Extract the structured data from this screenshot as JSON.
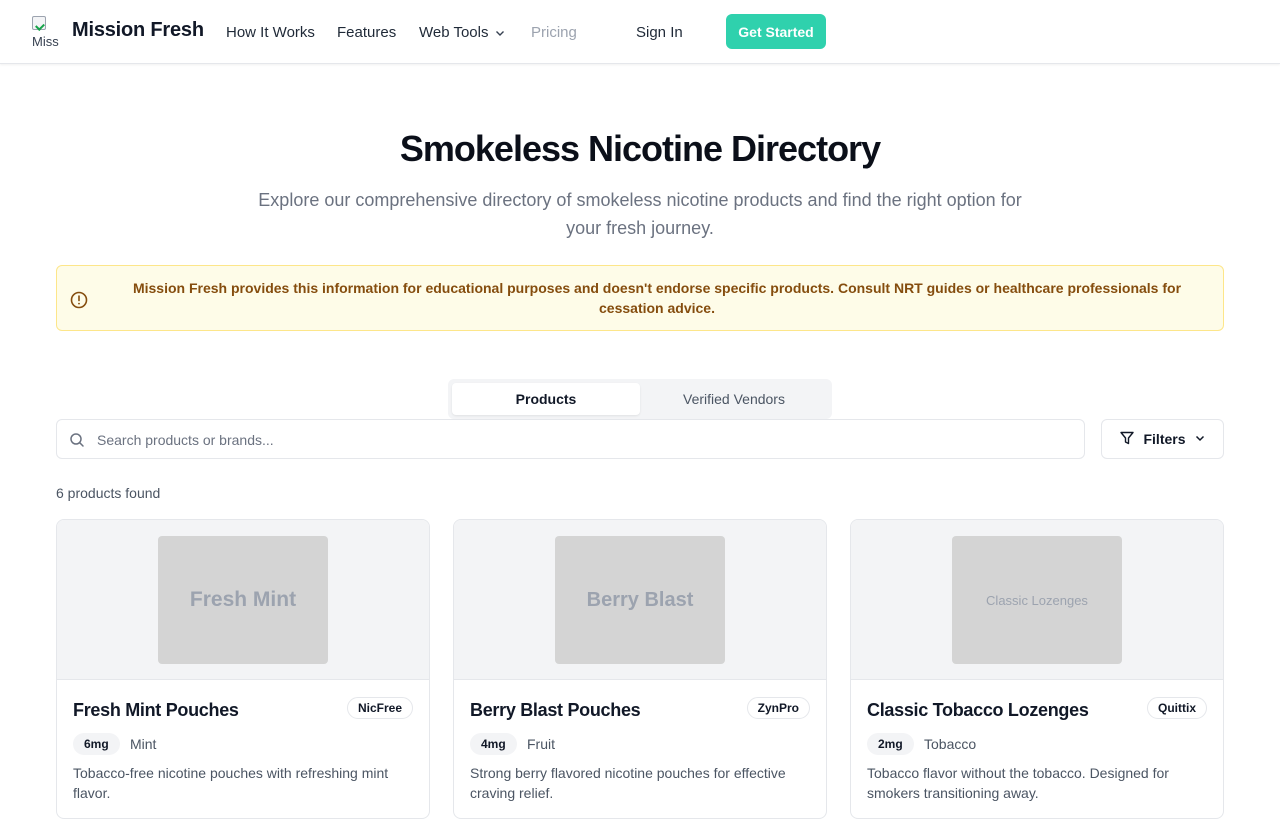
{
  "header": {
    "logo_alt": "Miss",
    "brand": "Mission Fresh",
    "nav": [
      {
        "label": "How It Works"
      },
      {
        "label": "Features"
      },
      {
        "label": "Web Tools"
      },
      {
        "label": "Pricing"
      }
    ],
    "sign_in": "Sign In",
    "get_started": "Get Started"
  },
  "hero": {
    "title": "Smokeless Nicotine Directory",
    "subtitle": "Explore our comprehensive directory of smokeless nicotine products and find the right option for your fresh journey."
  },
  "notice": {
    "text": "Mission Fresh provides this information for educational purposes and doesn't endorse specific products. Consult NRT guides or healthcare professionals for cessation advice."
  },
  "tabs": [
    {
      "label": "Products",
      "active": true
    },
    {
      "label": "Verified Vendors",
      "active": false
    }
  ],
  "search": {
    "placeholder": "Search products or brands...",
    "value": ""
  },
  "filters_label": "Filters",
  "results_count": "6 products found",
  "products": [
    {
      "image_text": "Fresh Mint",
      "name": "Fresh Mint Pouches",
      "brand": "NicFree",
      "strength": "6mg",
      "flavor": "Mint",
      "description": "Tobacco-free nicotine pouches with refreshing mint flavor."
    },
    {
      "image_text": "Berry Blast",
      "name": "Berry Blast Pouches",
      "brand": "ZynPro",
      "strength": "4mg",
      "flavor": "Fruit",
      "description": "Strong berry flavored nicotine pouches for effective craving relief."
    },
    {
      "image_text": "Classic Lozenges",
      "name": "Classic Tobacco Lozenges",
      "brand": "Quittix",
      "strength": "2mg",
      "flavor": "Tobacco",
      "description": "Tobacco flavor without the tobacco. Designed for smokers transitioning away."
    }
  ],
  "colors": {
    "accent": "#2fd1ad",
    "notice_bg": "#fefce8",
    "notice_text": "#854d0e"
  }
}
